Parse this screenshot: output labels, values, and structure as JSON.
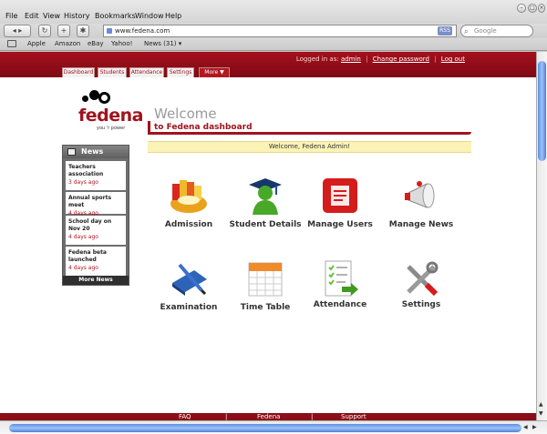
{
  "browser": {
    "menus": [
      "File",
      "Edit",
      "View",
      "History",
      "Bookmarks",
      "Window",
      "Help"
    ],
    "url": "www.fedena.com",
    "rss_label": "RSS",
    "search_placeholder": "Google",
    "bookmarks": [
      "Apple",
      "Amazon",
      "eBay",
      "Yahoo!",
      "News (31) ▾"
    ]
  },
  "header": {
    "logged_in_label": "Logged in as:",
    "user": "admin",
    "change_password": "Change password",
    "logout": "Log out"
  },
  "tabs": [
    "Dashboard",
    "Students",
    "Attendance",
    "Settings",
    "More ▼"
  ],
  "logo": {
    "word": "fedena",
    "tagline": "you 'r power"
  },
  "news": {
    "title": "News",
    "items": [
      {
        "title": "Teachers association",
        "date": "3 days ago"
      },
      {
        "title": "Annual sports meet",
        "date": "4 days ago"
      },
      {
        "title": "School day on Nov 20",
        "date": "4 days ago"
      },
      {
        "title": "Fedena beta launched",
        "date": "4 days ago"
      }
    ],
    "more": "More News"
  },
  "welcome": {
    "title": "Welcome",
    "subtitle": "to Fedena dashboard",
    "banner": "Welcome, Fedena Admin!"
  },
  "tiles": [
    {
      "label": "Admission",
      "icon": "admission-icon"
    },
    {
      "label": "Student Details",
      "icon": "graduate-icon"
    },
    {
      "label": "Manage Users",
      "icon": "users-icon"
    },
    {
      "label": "Manage News",
      "icon": "megaphone-icon"
    },
    {
      "label": "Examination",
      "icon": "book-pencil-icon"
    },
    {
      "label": "Time Table",
      "icon": "calendar-icon"
    },
    {
      "label": "Attendance",
      "icon": "checklist-icon"
    },
    {
      "label": "Settings",
      "icon": "tools-icon"
    }
  ],
  "footer": [
    "FAQ",
    "|",
    "Fedena",
    "|",
    "Support"
  ],
  "colors": {
    "brand": "#a0131d",
    "banner": "#fbf3b5"
  }
}
